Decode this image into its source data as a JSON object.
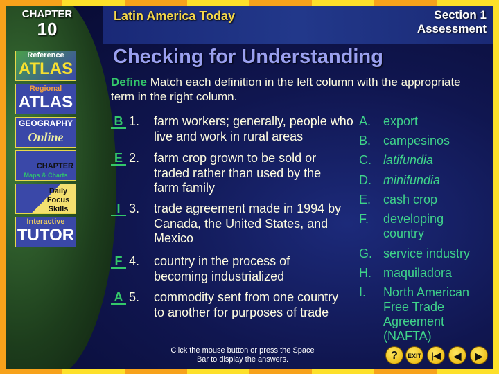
{
  "header": {
    "chapter_label": "CHAPTER",
    "chapter_number": "10",
    "title": "Latin America Today",
    "section": "Section 1",
    "subsection": "Assessment"
  },
  "sidebar": [
    {
      "top": "Reference",
      "bottom": "ATLAS"
    },
    {
      "top": "Regional",
      "bottom": "ATLAS"
    },
    {
      "top": "GEOGRAPHY",
      "bottom": "Online"
    },
    {
      "top": "CHAPTER",
      "bottom": "Maps & Charts"
    },
    {
      "top": "Daily Focus Skills",
      "bottom": ""
    },
    {
      "top": "Interactive",
      "bottom": "TUTOR"
    }
  ],
  "main": {
    "title": "Checking for Understanding",
    "instruction_label": "Define",
    "instruction_text": " Match each definition in the left column with the appropriate term in the right column.",
    "questions": [
      {
        "answer": "B",
        "number": "1.",
        "text": "farm workers; generally, people who live and work in rural areas"
      },
      {
        "answer": "E",
        "number": "2.",
        "text": "farm crop grown to be sold or traded rather than used by the farm family"
      },
      {
        "answer": "I",
        "number": "3.",
        "text": "trade agreement made in 1994 by Canada, the United States, and Mexico"
      },
      {
        "answer": "F",
        "number": "4.",
        "text": "country in the process of becoming industrialized"
      },
      {
        "answer": "A",
        "number": "5.",
        "text": "commodity sent from one country to another for purposes of trade"
      }
    ],
    "terms": [
      {
        "letter": "A.",
        "term": "export"
      },
      {
        "letter": "B.",
        "term": "campesinos"
      },
      {
        "letter": "C.",
        "term": "latifundia"
      },
      {
        "letter": "D.",
        "term": "minifundia"
      },
      {
        "letter": "E.",
        "term": "cash crop"
      },
      {
        "letter": "F.",
        "term": "developing country"
      },
      {
        "letter": "G.",
        "term": "service industry"
      },
      {
        "letter": "H.",
        "term": "maquiladora"
      },
      {
        "letter": "I.",
        "term": "North American Free Trade Agreement (NAFTA)"
      }
    ]
  },
  "footer": {
    "hint": "Click the mouse button or press the Space Bar to display the answers.",
    "help": "?",
    "exit": "EXIT"
  },
  "colors": {
    "answer": "#34c86a",
    "text": "#fffde0",
    "title": "#9aa0f0",
    "header_title": "#f6d84a"
  }
}
